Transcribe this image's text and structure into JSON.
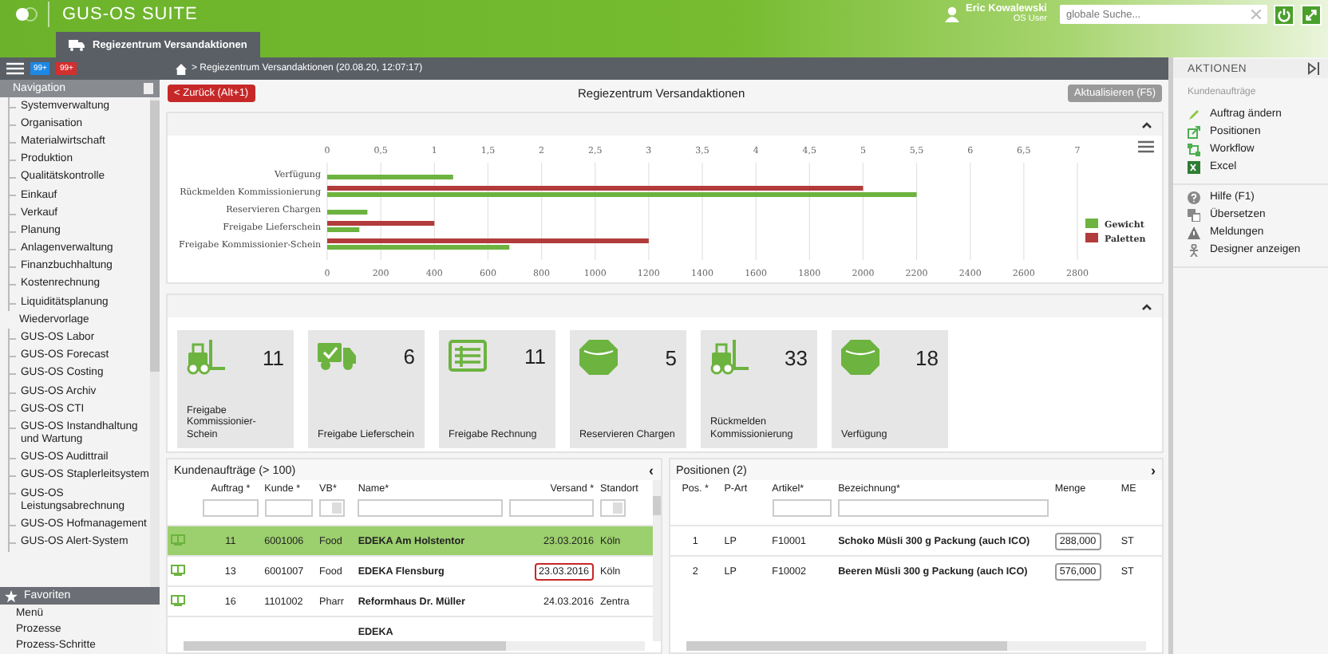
{
  "header": {
    "app_title": "GUS-OS SUITE",
    "user_name": "Eric Kowalewski",
    "user_role": "OS User",
    "search": {
      "placeholder": "globale Suche..."
    }
  },
  "tabs": [
    {
      "label": "Regiezentrum Versandaktionen",
      "selected": true
    }
  ],
  "badges": [
    {
      "label": "99+",
      "color": "#1e88e5"
    },
    {
      "label": "99+",
      "color": "#d32f2f"
    }
  ],
  "breadcrumb": "> Regiezentrum Versandaktionen (20.08.20, 12:07:17)",
  "sidebar": {
    "navigation": {
      "title": "Navigation",
      "items": [
        {
          "label": "Systemverwaltung",
          "expandable": true
        },
        {
          "label": "Organisation",
          "expandable": true
        },
        {
          "label": "Materialwirtschaft",
          "expandable": true
        },
        {
          "label": "Produktion",
          "expandable": true
        },
        {
          "label": "Qualitätskontrolle",
          "expandable": true
        },
        {
          "label": "Einkauf",
          "expandable": true
        },
        {
          "label": "Verkauf",
          "expandable": true
        },
        {
          "label": "Planung",
          "expandable": true
        },
        {
          "label": "Anlagenverwaltung",
          "expandable": true
        },
        {
          "label": "Finanzbuchhaltung",
          "expandable": true
        },
        {
          "label": "Kostenrechnung",
          "expandable": true
        },
        {
          "label": "Liquiditätsplanung",
          "expandable": true
        },
        {
          "label": "Wiedervorlage",
          "expandable": false
        },
        {
          "label": "GUS-OS Labor",
          "expandable": true
        },
        {
          "label": "GUS-OS Forecast",
          "expandable": true
        },
        {
          "label": "GUS-OS Costing",
          "expandable": true
        },
        {
          "label": "GUS-OS Archiv",
          "expandable": true
        },
        {
          "label": "GUS-OS CTI",
          "expandable": true
        },
        {
          "label": "GUS-OS Instandhaltung und Wartung",
          "expandable": true
        },
        {
          "label": "GUS-OS Audittrail",
          "expandable": true
        },
        {
          "label": "GUS-OS Staplerleitsystem",
          "expandable": true
        },
        {
          "label": "GUS-OS Leistungsabrechnung",
          "expandable": true
        },
        {
          "label": "GUS-OS Hofmanagement",
          "expandable": true
        },
        {
          "label": "GUS-OS Alert-System",
          "expandable": true
        }
      ]
    },
    "favorites": {
      "title": "Favoriten",
      "items": [
        "Menü",
        "Prozesse",
        "Prozess-Schritte"
      ]
    }
  },
  "toolbar": {
    "back_button": "< Zurück (Alt+1)",
    "title": "Regiezentrum Versandaktionen",
    "refresh_button": "Aktualisieren (F5)"
  },
  "chart_panel": {
    "chart_data": {
      "type": "bar",
      "orientation": "horizontal",
      "categories": [
        "Verfügung",
        "Rückmelden Kommissionierung",
        "Reservieren Chargen",
        "Freigabe Lieferschein",
        "Freigabe Kommissionier-Schein"
      ],
      "series": [
        {
          "name": "Gewicht",
          "color": "#6cb33f",
          "values": [
            470,
            2200,
            150,
            120,
            680
          ]
        },
        {
          "name": "Paletten",
          "color": "#b23b3b",
          "values": [
            null,
            2000,
            null,
            400,
            1200
          ]
        }
      ],
      "grid": true,
      "legend": "right",
      "xlim": [
        0,
        2800
      ],
      "xticks": [
        0,
        200,
        400,
        600,
        800,
        1000,
        1200,
        1400,
        1600,
        1800,
        2000,
        2200,
        2400,
        2600,
        2800
      ],
      "x2lim": [
        0,
        7
      ],
      "x2ticks": [
        0,
        {
          "value": 0.5,
          "label": "0,5"
        },
        1,
        {
          "value": 1.5,
          "label": "1,5"
        },
        2,
        {
          "value": 2.5,
          "label": "2,5"
        },
        3,
        {
          "value": 3.5,
          "label": "3,5"
        },
        4,
        {
          "value": 4.5,
          "label": "4,5"
        },
        5,
        {
          "value": 5.5,
          "label": "5,5"
        },
        6,
        {
          "value": 6.5,
          "label": "6,5"
        },
        7
      ]
    }
  },
  "tiles": [
    {
      "kind": "forklift",
      "count": "11",
      "label": "Freigabe Kommissionier-Schein"
    },
    {
      "kind": "truck",
      "count": "6",
      "label": "Freigabe Lieferschein"
    },
    {
      "kind": "invoice",
      "count": "11",
      "label": "Freigabe Rechnung"
    },
    {
      "kind": "box",
      "count": "5",
      "label": "Reservieren Chargen"
    },
    {
      "kind": "forklift",
      "count": "33",
      "label": "Rückmelden Kommissionierung"
    },
    {
      "kind": "box",
      "count": "18",
      "label": "Verfügung"
    }
  ],
  "orders": {
    "title": "Kundenaufträge (> 100)",
    "collapse": "‹",
    "columns": [
      {
        "label": "Auftrag *",
        "kind": "input"
      },
      {
        "label": "Kunde *",
        "kind": "input"
      },
      {
        "label": "VB*",
        "kind": "select"
      },
      {
        "label": "Name*",
        "kind": "input"
      },
      {
        "label": "Versand *",
        "kind": "input"
      },
      {
        "label": "Standort",
        "kind": "select"
      }
    ],
    "rows": [
      {
        "selected": true,
        "flagged": false,
        "cells": [
          "11",
          "6001006",
          "Food",
          "EDEKA Am Holstentor",
          "23.03.2016",
          "Köln"
        ]
      },
      {
        "selected": false,
        "flagged": true,
        "cells": [
          "13",
          "6001007",
          "Food",
          "EDEKA Flensburg",
          "23.03.2016",
          "Köln"
        ]
      },
      {
        "selected": false,
        "flagged": false,
        "cells": [
          "16",
          "1101002",
          "Pharr",
          "Reformhaus Dr. Müller",
          "24.03.2016",
          "Zentra"
        ]
      },
      {
        "selected": false,
        "flagged": false,
        "cells": [
          "",
          "",
          "",
          "EDEKA",
          "",
          ""
        ]
      }
    ]
  },
  "positions": {
    "title": "Positionen (2)",
    "collapse": "›",
    "columns": [
      {
        "label": "Pos. *",
        "kind": "plain"
      },
      {
        "label": "P-Art",
        "kind": "plain"
      },
      {
        "label": "Artikel*",
        "kind": "input"
      },
      {
        "label": "Bezeichnung*",
        "kind": "input"
      },
      {
        "label": "Menge",
        "kind": "plain"
      },
      {
        "label": "ME",
        "kind": "plain"
      }
    ],
    "rows": [
      {
        "cells": [
          "1",
          "LP",
          "F10001",
          "Schoko Müsli 300 g Packung (auch ICO)",
          "288,000",
          "ST"
        ]
      },
      {
        "cells": [
          "2",
          "LP",
          "F10002",
          "Beeren Müsli 300 g Packung (auch ICO)",
          "576,000",
          "ST"
        ]
      }
    ]
  },
  "actions": {
    "title": "AKTIONEN",
    "section": "Kundenaufträge",
    "groups": [
      [
        {
          "kind": "pencil",
          "label": "Auftrag ändern"
        },
        {
          "kind": "external",
          "label": "Positionen"
        },
        {
          "kind": "workflow",
          "label": "Workflow"
        },
        {
          "kind": "excel",
          "label": "Excel"
        }
      ],
      [
        {
          "kind": "help",
          "label": "Hilfe (F1)"
        },
        {
          "kind": "translate",
          "label": "Übersetzen"
        },
        {
          "kind": "warning",
          "label": "Meldungen"
        },
        {
          "kind": "person",
          "label": "Designer anzeigen"
        }
      ]
    ]
  }
}
